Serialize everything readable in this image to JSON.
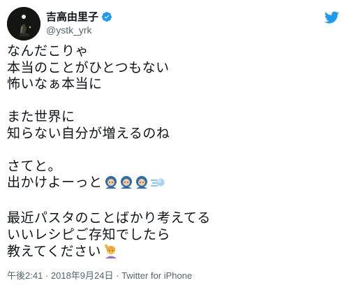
{
  "author": {
    "display_name": "吉高由里子",
    "handle": "@ystk_yrk",
    "verified": true
  },
  "tweet": {
    "paragraphs": [
      [
        "なんだこりゃ",
        "本当のことがひとつもない",
        "怖いなぁ本当に"
      ],
      [
        "また世界に",
        "知らない自分が増えるのね"
      ],
      [
        "さてと。",
        "出かけよーっと"
      ],
      [
        "最近パスタのことばかり考えてる",
        "いいレシピご存知でしたら",
        "教えてください"
      ]
    ],
    "emoji_sequences": {
      "going_out": [
        "woman-with-headscarf-icon",
        "woman-with-headscarf-icon",
        "woman-with-headscarf-icon",
        "dash-icon"
      ],
      "please": "raising-hand-icon"
    }
  },
  "meta": {
    "time": "午後2:41",
    "separator": " · ",
    "date": "2018年9月24日",
    "source": "Twitter for iPhone"
  },
  "colors": {
    "text": "#0f1419",
    "secondary": "#536471",
    "brand_blue": "#1d9bf0"
  }
}
